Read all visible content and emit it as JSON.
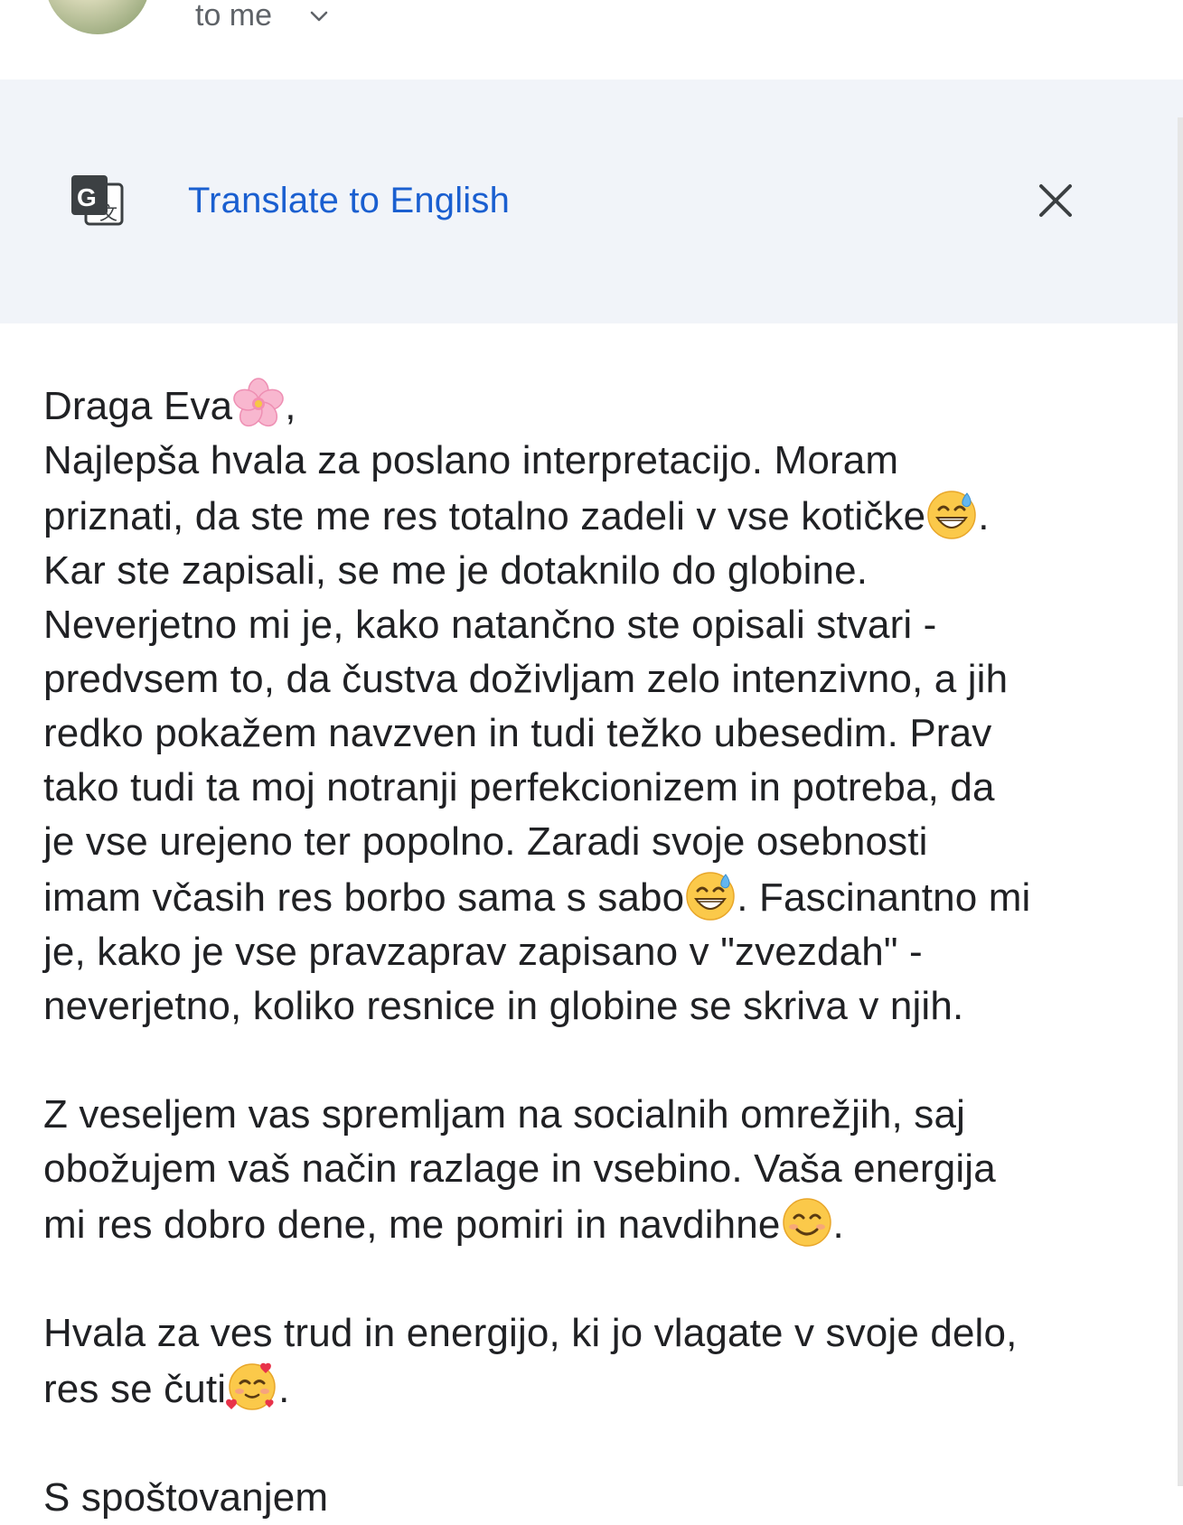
{
  "header": {
    "recipient_text": "to me"
  },
  "translate_bar": {
    "link_label": "Translate to English"
  },
  "message": {
    "lines": [
      {
        "text": "Draga Eva",
        "emoji": "cherry-blossom-emoji",
        "after": ","
      },
      {
        "text": "Najlepša hvala za poslano interpretacijo. Moram"
      },
      {
        "text": "priznati, da ste me res totalno zadeli v vse kotičke",
        "emoji": "grinning-sweat-emoji",
        "after": "."
      },
      {
        "text": "Kar ste zapisali, se me je dotaknilo do globine."
      },
      {
        "text": "Neverjetno mi je, kako natančno ste opisali stvari -"
      },
      {
        "text": "predvsem to, da čustva doživljam zelo intenzivno, a jih"
      },
      {
        "text": "redko pokažem navzven in tudi težko ubesedim. Prav"
      },
      {
        "text": "tako tudi ta moj notranji perfekcionizem in potreba, da"
      },
      {
        "text": "je vse urejeno ter popolno. Zaradi svoje osebnosti"
      },
      {
        "text": "imam včasih res borbo sama s sabo",
        "emoji": "grinning-sweat-emoji",
        "after": ". Fascinantno mi"
      },
      {
        "text": "je, kako je vse pravzaprav zapisano v \"zvezdah\" -"
      },
      {
        "text": "neverjetno, koliko resnice in globine se skriva v njih."
      },
      {
        "gap": true
      },
      {
        "text": "Z veseljem vas spremljam na socialnih omrežjih, saj"
      },
      {
        "text": "obožujem vaš način razlage in vsebino. Vaša energija"
      },
      {
        "text": "mi res dobro dene, me pomiri in navdihne",
        "emoji": "smiling-emoji",
        "after": "."
      },
      {
        "gap": true
      },
      {
        "text": "Hvala za ves trud in energijo, ki jo vlagate v svoje delo,"
      },
      {
        "text": "res se čuti",
        "emoji": "smiling-hearts-emoji",
        "after": "."
      },
      {
        "gap": true
      },
      {
        "text": "S spoštovanjem"
      }
    ]
  },
  "icons": {
    "translate": "translate-icon",
    "close": "close-icon",
    "chevron": "chevron-down-icon"
  },
  "colors": {
    "link": "#1a5fd0",
    "banner_bg": "#f1f4f9",
    "text": "#202124",
    "secondary_text": "#5f6368"
  }
}
